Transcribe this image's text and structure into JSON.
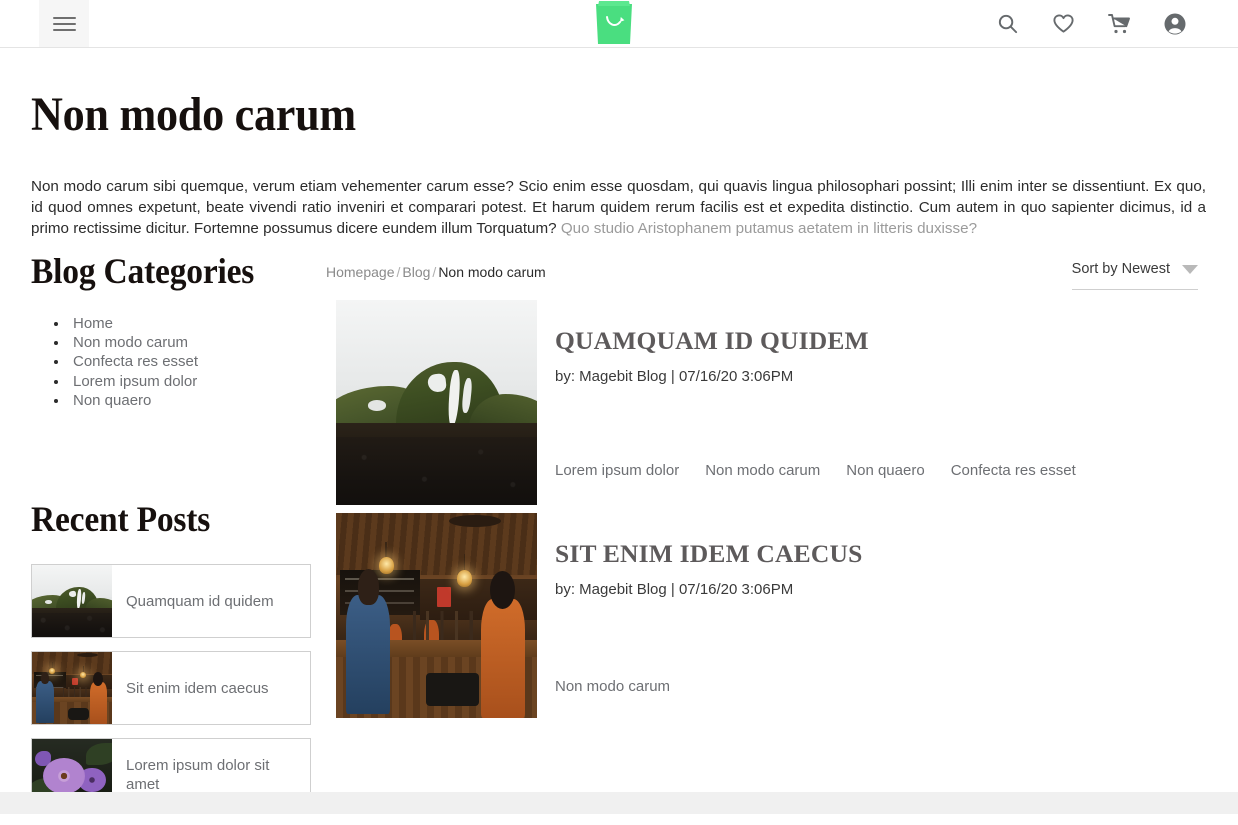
{
  "header": {
    "menu_label": "menu",
    "logo_alt": "Magebit shopping bag logo",
    "logo_color": "#4ade80",
    "icons": [
      {
        "name": "search-icon",
        "label": "Search"
      },
      {
        "name": "wishlist-icon",
        "label": "Wish List"
      },
      {
        "name": "cart-icon",
        "label": "Shopping Cart"
      },
      {
        "name": "account-icon",
        "label": "My Account"
      }
    ]
  },
  "page": {
    "title": "Non modo carum",
    "intro_main": "Non modo carum sibi quemque, verum etiam vehementer carum esse? Scio enim esse quosdam, qui quavis lingua philosophari possint; Illi enim inter se dissentiunt. Ex quo, id quod omnes expetunt, beate vivendi ratio inveniri et comparari potest. Et harum quidem rerum facilis est et expedita distinctio. Cum autem in quo sapienter dicimus, id a primo rectissime dicitur. Fortemne possumus dicere eundem illum Torquatum?",
    "intro_muted": "Quo studio Aristophanem putamus aetatem in litteris duxisse?"
  },
  "breadcrumb": {
    "items": [
      {
        "label": "Homepage",
        "current": false
      },
      {
        "label": "Blog",
        "current": false
      },
      {
        "label": "Non modo carum",
        "current": true
      }
    ],
    "separator": "/"
  },
  "sorter": {
    "label": "Sort by Newest",
    "caret": "chevron-down-icon"
  },
  "sidebar": {
    "categories_title": "Blog Categories",
    "categories": [
      {
        "label": "Home"
      },
      {
        "label": "Non modo carum"
      },
      {
        "label": "Confecta res esset"
      },
      {
        "label": "Lorem ipsum dolor"
      },
      {
        "label": "Non quaero"
      }
    ],
    "recent_title": "Recent Posts",
    "recent_posts": [
      {
        "label": "Quamquam id quidem",
        "thumb": "mountain"
      },
      {
        "label": "Sit enim idem caecus",
        "thumb": "bar"
      },
      {
        "label": "Lorem ipsum dolor sit amet",
        "thumb": "flower"
      }
    ]
  },
  "posts": [
    {
      "title": "QUAMQUAM ID QUIDEM",
      "meta": "by: Magebit Blog | 07/16/20 3:06PM",
      "image": "mountain",
      "tags": [
        "Lorem ipsum dolor",
        "Non modo carum",
        "Non quaero",
        "Confecta res esset"
      ]
    },
    {
      "title": "SIT ENIM IDEM CAECUS",
      "meta": "by: Magebit Blog | 07/16/20 3:06PM",
      "image": "bar",
      "tags": [
        "Non modo carum"
      ]
    }
  ],
  "colors": {
    "accent_green": "#4ade80",
    "post_title": "#5d5a5b",
    "muted_text": "#9b9b9b",
    "body_text": "#2b2b2b",
    "footer_band": "#f0f0f0"
  }
}
